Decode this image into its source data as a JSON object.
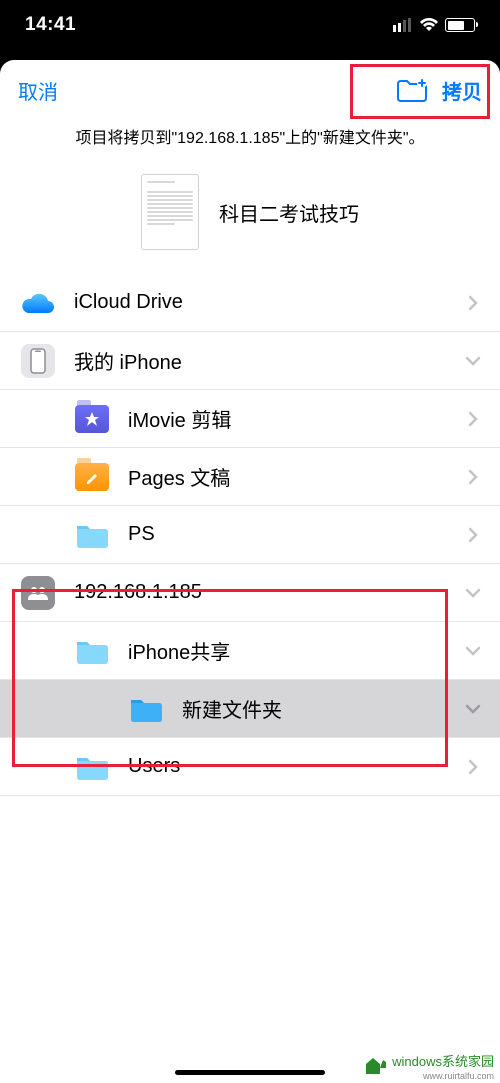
{
  "status": {
    "time": "14:41"
  },
  "header": {
    "cancel": "取消",
    "copy": "拷贝"
  },
  "info_text": "项目将拷贝到\"192.168.1.185\"上的\"新建文件夹\"。",
  "document": {
    "title": "科目二考试技巧"
  },
  "locations": [
    {
      "label": "iCloud Drive",
      "acc": "chevron"
    },
    {
      "label": "我的 iPhone",
      "acc": "expand"
    }
  ],
  "folders": {
    "imovie": "iMovie 剪辑",
    "pages": "Pages 文稿",
    "ps": "PS"
  },
  "server": {
    "label": "192.168.1.185",
    "share": "iPhone共享",
    "newfolder": "新建文件夹",
    "users": "Users"
  },
  "watermark": {
    "main": "windows系统家园",
    "sub": "www.ruirtalfu.com"
  }
}
